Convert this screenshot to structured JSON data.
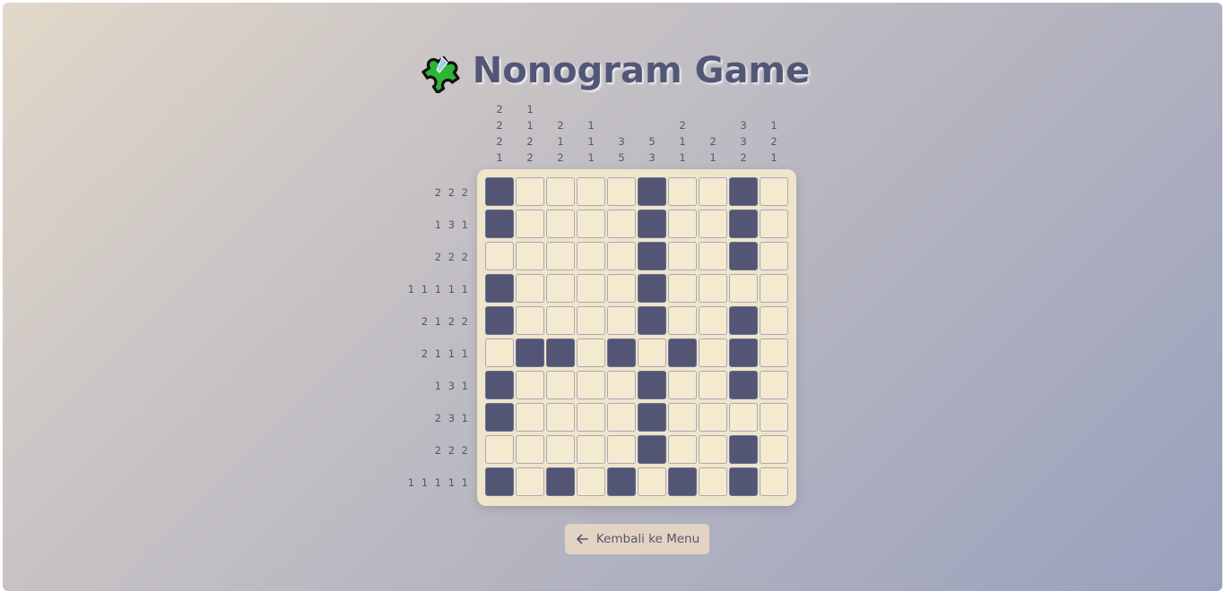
{
  "header": {
    "title": "Nonogram Game",
    "icon": "puzzle-piece-icon"
  },
  "colors": {
    "filled": "#525574",
    "empty": "#f4ead0",
    "board": "#efe5cb",
    "text": "#53576f"
  },
  "clues": {
    "columns": [
      [
        "2",
        "2",
        "2",
        "1"
      ],
      [
        "1",
        "1",
        "2",
        "2"
      ],
      [
        "2",
        "1",
        "2"
      ],
      [
        "1",
        "1",
        "1"
      ],
      [
        "3",
        "5"
      ],
      [
        "5",
        "3"
      ],
      [
        "2",
        "1",
        "1"
      ],
      [
        "2",
        "1"
      ],
      [
        "3",
        "3",
        "2"
      ],
      [
        "1",
        "2",
        "1"
      ]
    ],
    "rows": [
      "2 2 2",
      "1 3 1",
      "2 2 2",
      "1 1 1 1 1",
      "2 1 2 2",
      "2 1 1 1",
      "1 3 1",
      "2 3 1",
      "2 2 2",
      "1 1 1 1 1"
    ]
  },
  "grid": [
    [
      1,
      0,
      0,
      0,
      0,
      1,
      0,
      0,
      1,
      0
    ],
    [
      1,
      0,
      0,
      0,
      0,
      1,
      0,
      0,
      1,
      0
    ],
    [
      0,
      0,
      0,
      0,
      0,
      1,
      0,
      0,
      1,
      0
    ],
    [
      1,
      0,
      0,
      0,
      0,
      1,
      0,
      0,
      0,
      0
    ],
    [
      1,
      0,
      0,
      0,
      0,
      1,
      0,
      0,
      1,
      0
    ],
    [
      0,
      1,
      1,
      0,
      1,
      0,
      1,
      0,
      1,
      0
    ],
    [
      1,
      0,
      0,
      0,
      0,
      1,
      0,
      0,
      1,
      0
    ],
    [
      1,
      0,
      0,
      0,
      0,
      1,
      0,
      0,
      0,
      0
    ],
    [
      0,
      0,
      0,
      0,
      0,
      1,
      0,
      0,
      1,
      0
    ],
    [
      1,
      0,
      1,
      0,
      1,
      0,
      1,
      0,
      1,
      0
    ]
  ],
  "back_button": {
    "label": "Kembali ke Menu",
    "icon": "arrow-left-icon"
  }
}
